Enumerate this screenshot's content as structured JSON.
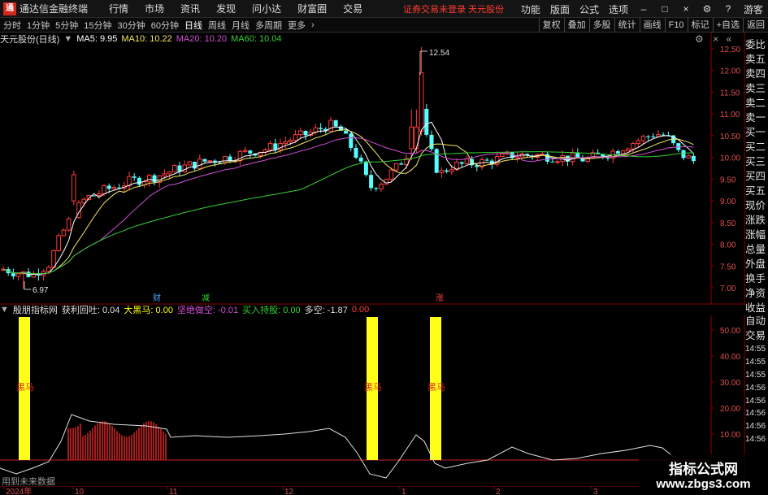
{
  "titlebar": {
    "logo": "通",
    "app_name": "通达信金融终端",
    "menu": [
      "行情",
      "市场",
      "资讯",
      "发现",
      "问小达",
      "财富圈",
      "交易"
    ],
    "warning": "证券交易未登录 天元股份",
    "right_menu": [
      "功能",
      "版面",
      "公式",
      "选项"
    ],
    "guest": "游客"
  },
  "toolbar": {
    "periods": [
      "分时",
      "1分钟",
      "5分钟",
      "15分钟",
      "30分钟",
      "60分钟",
      "日线",
      "周线",
      "月线",
      "多周期",
      "更多"
    ],
    "active_period": "日线",
    "right_buttons": [
      "复权",
      "叠加",
      "多股",
      "统计",
      "画线",
      "F10",
      "标记",
      "+自选",
      "返回"
    ]
  },
  "main_chart": {
    "name": "天元股份(日线)",
    "ma_labels": [
      {
        "label": "MA5: 9.95",
        "color": "#ffffff"
      },
      {
        "label": "MA10: 10.22",
        "color": "#f5e663"
      },
      {
        "label": "MA20: 10.20",
        "color": "#d14fd6"
      },
      {
        "label": "MA60: 10.04",
        "color": "#35d035"
      }
    ],
    "high_label": "12.54",
    "low_label": "6.97",
    "y_ticks": [
      "12.50",
      "12.00",
      "11.50",
      "11.00",
      "10.50",
      "10.00",
      "9.50",
      "9.00",
      "8.50",
      "8.00",
      "7.50",
      "7.00"
    ],
    "event_marks": [
      {
        "text": "财",
        "color": "#4fa3ff"
      },
      {
        "text": "减",
        "color": "#35d035"
      },
      {
        "text": "涨",
        "color": "#ff4040"
      }
    ]
  },
  "indicator": {
    "name": "殷朋指标网",
    "items": [
      {
        "label": "获利回吐: 0.04",
        "color": "#e0e0e0"
      },
      {
        "label": "大黑马: 0.00",
        "color": "#ffff00"
      },
      {
        "label": "坚绝做空: -0.01",
        "color": "#d14fd6"
      },
      {
        "label": "买入持股: 0.00",
        "color": "#35d035"
      },
      {
        "label": "多空: -1.87",
        "color": "#e0e0e0"
      },
      {
        "label": "0.00",
        "color": "#ff4040"
      }
    ],
    "y_ticks": [
      "50.00",
      "40.00",
      "30.00",
      "20.00",
      "10.00"
    ],
    "bar_label": "黑马"
  },
  "x_axis": [
    "2024年",
    "10",
    "11",
    "12",
    "1",
    "2",
    "3"
  ],
  "side_panel": {
    "labels": [
      "委比",
      "卖五",
      "卖四",
      "卖三",
      "卖二",
      "卖一",
      "买一",
      "买二",
      "买三",
      "买四",
      "买五",
      "现价",
      "涨跌",
      "涨幅",
      "总量",
      "外盘",
      "换手",
      "净资",
      "收益"
    ],
    "auto_labels": [
      "自动",
      "交易"
    ],
    "times": [
      "14:55",
      "14:55",
      "14:55",
      "14:56",
      "14:56",
      "14:56",
      "14:56",
      "14:56"
    ]
  },
  "footer_note": "用到未来数据",
  "watermark": {
    "line1": "指标公式网",
    "line2": "www.zbgs3.com"
  },
  "colors": {
    "up": "#ff3b3b",
    "down": "#54ffff",
    "bg": "#000000",
    "ma5": "#ffffff",
    "ma10": "#f5e663",
    "ma20": "#d14fd6",
    "ma60": "#35d035",
    "yellow_bar": "#ffff1a",
    "grid_red": "#8b0000"
  },
  "chart_data": {
    "type": "candlestick",
    "ylim": [
      6.97,
      12.54
    ],
    "x_labels": [
      "2024年",
      "10",
      "11",
      "12",
      "1",
      "2",
      "3"
    ],
    "ma": {
      "MA5": 9.95,
      "MA10": 10.22,
      "MA20": 10.2,
      "MA60": 10.04
    }
  }
}
